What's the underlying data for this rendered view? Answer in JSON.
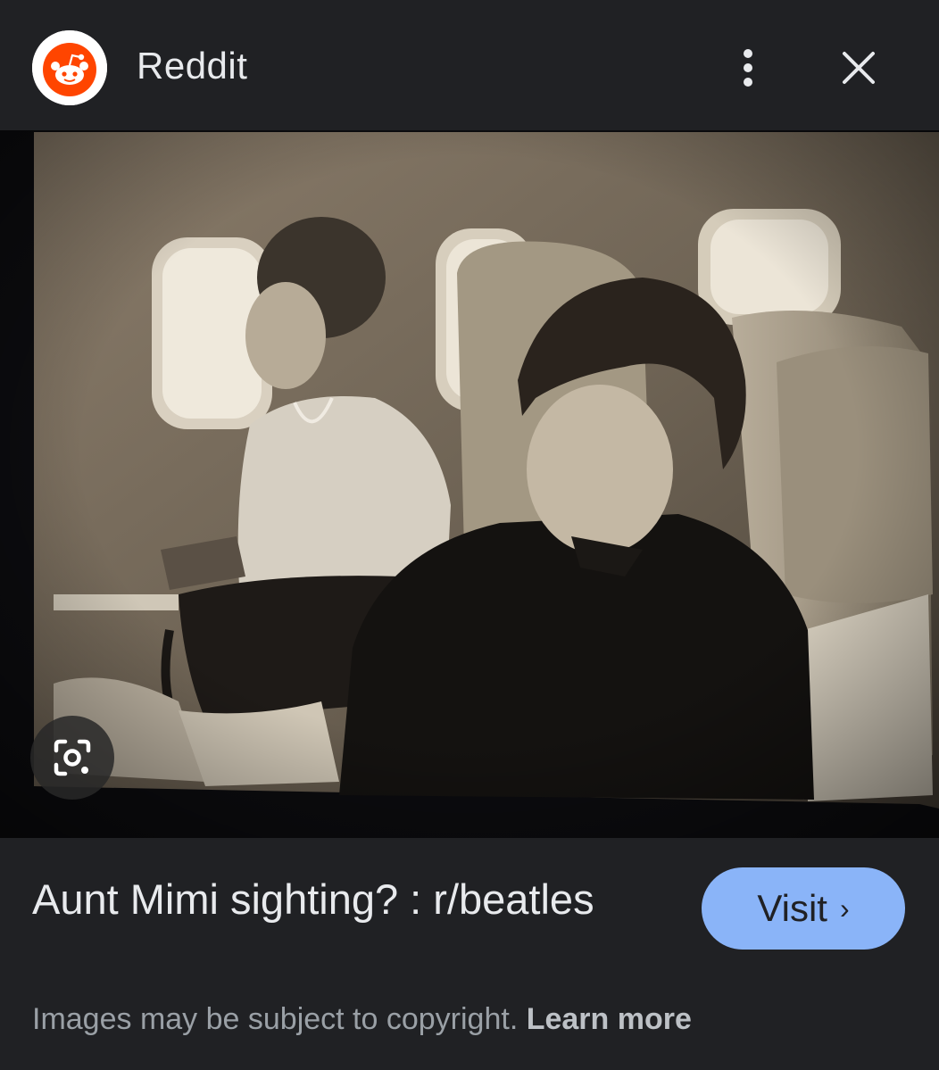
{
  "header": {
    "site_name": "Reddit",
    "logo_icon": "reddit-snoo-icon",
    "menu_icon": "more-vert-icon",
    "close_icon": "close-icon"
  },
  "image": {
    "lens_icon": "google-lens-icon"
  },
  "result": {
    "title": "Aunt Mimi sighting? : r/beatles",
    "visit_label": "Visit",
    "visit_chevron": "›",
    "copyright_text": "Images may be subject to copyright.",
    "learn_more_label": "Learn more"
  },
  "colors": {
    "background": "#202124",
    "accent": "#8ab4f8",
    "reddit_orange": "#ff4500"
  }
}
